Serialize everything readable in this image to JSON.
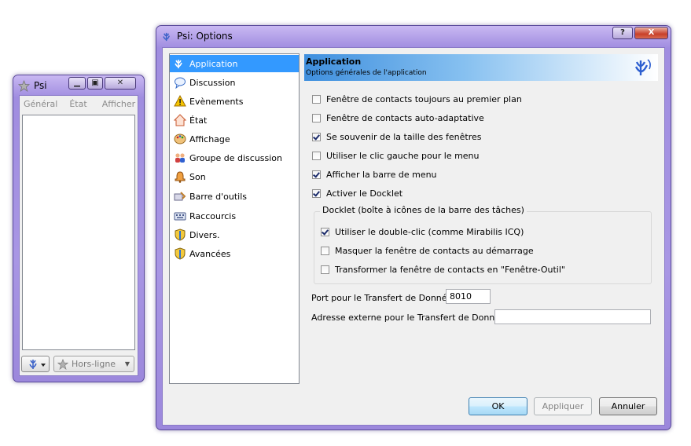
{
  "psi_window": {
    "title": "Psi",
    "menu": [
      "Général",
      "État",
      "Afficher"
    ],
    "status": "Hors-ligne"
  },
  "options_window": {
    "title": "Psi: Options",
    "help_button": "?",
    "close_button": "X",
    "nav": [
      {
        "label": "Application",
        "icon": "psi-logo-icon",
        "selected": true
      },
      {
        "label": "Discussion",
        "icon": "speech-bubble-icon"
      },
      {
        "label": "Evènements",
        "icon": "warning-icon"
      },
      {
        "label": "État",
        "icon": "house-icon"
      },
      {
        "label": "Affichage",
        "icon": "palette-icon"
      },
      {
        "label": "Groupe de discussion",
        "icon": "group-users-icon"
      },
      {
        "label": "Son",
        "icon": "bell-icon"
      },
      {
        "label": "Barre d'outils",
        "icon": "toolbar-icon"
      },
      {
        "label": "Raccourcis",
        "icon": "keyboard-icon"
      },
      {
        "label": "Divers.",
        "icon": "shield-icon"
      },
      {
        "label": "Avancées",
        "icon": "shield-icon"
      }
    ],
    "header": {
      "title": "Application",
      "subtitle": "Options générales de l'application"
    },
    "options": [
      {
        "label": "Fenêtre de contacts toujours au premier plan",
        "checked": false
      },
      {
        "label": "Fenêtre de contacts auto-adaptative",
        "checked": false
      },
      {
        "label": "Se souvenir de la taille des fenêtres",
        "checked": true
      },
      {
        "label": "Utiliser le clic gauche pour le menu",
        "checked": false
      },
      {
        "label": "Afficher la barre de menu",
        "checked": true
      },
      {
        "label": "Activer le Docklet",
        "checked": true
      }
    ],
    "docklet_group": {
      "title": "Docklet (boîte à icônes de la barre des tâches)",
      "options": [
        {
          "label": "Utiliser le double-clic (comme Mirabilis ICQ)",
          "checked": true
        },
        {
          "label": "Masquer la fenêtre de contacts au démarrage",
          "checked": false
        },
        {
          "label": "Transformer la fenêtre de contacts en \"Fenêtre-Outil\"",
          "checked": false
        }
      ]
    },
    "port_label": "Port pour le Transfert de Données:",
    "port_value": "8010",
    "external_label": "Adresse externe pour le Transfert de Données:",
    "external_value": "",
    "buttons": {
      "ok": "OK",
      "apply": "Appliquer",
      "cancel": "Annuler"
    },
    "accent_color": "#3399ff"
  }
}
